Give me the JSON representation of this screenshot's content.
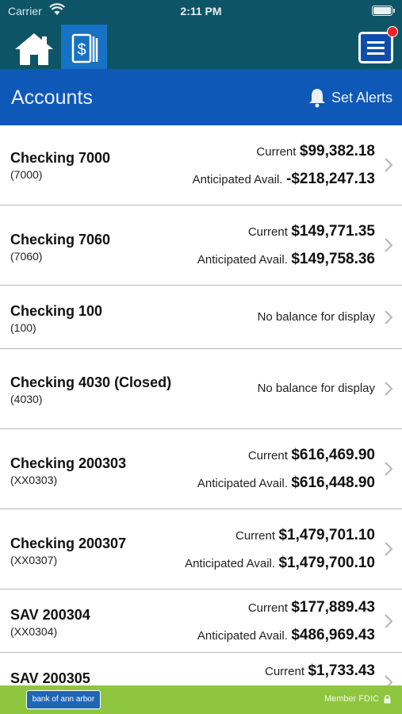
{
  "status_bar": {
    "carrier": "Carrier",
    "time": "2:11 PM"
  },
  "nav": {
    "home_icon": "home-icon",
    "accounts_icon": "dollar-bill-icon",
    "menu_icon": "hamburger-menu-icon",
    "notification_dot_color": "#e8242c",
    "active_tab": "accounts"
  },
  "header": {
    "title": "Accounts",
    "alerts_label": "Set Alerts",
    "alerts_icon": "bell-icon"
  },
  "accounts": [
    {
      "name": "Checking 7000",
      "number": "(7000)",
      "current_label": "Current",
      "current": "$99,382.18",
      "anticipated_label": "Anticipated Avail.",
      "anticipated": "-$218,247.13"
    },
    {
      "name": "Checking 7060",
      "number": "(7060)",
      "current_label": "Current",
      "current": "$149,771.35",
      "anticipated_label": "Anticipated Avail.",
      "anticipated": "$149,758.36"
    },
    {
      "name": "Checking 100",
      "number": "(100)",
      "no_balance": "No balance for display"
    },
    {
      "name": "Checking 4030 (Closed)",
      "number": "(4030)",
      "no_balance": "No balance for display"
    },
    {
      "name": "Checking 200303",
      "number": "(XX0303)",
      "current_label": "Current",
      "current": "$616,469.90",
      "anticipated_label": "Anticipated Avail.",
      "anticipated": "$616,448.90"
    },
    {
      "name": "Checking 200307",
      "number": "(XX0307)",
      "current_label": "Current",
      "current": "$1,479,701.10",
      "anticipated_label": "Anticipated Avail.",
      "anticipated": "$1,479,700.10"
    },
    {
      "name": "SAV 200304",
      "number": "(XX0304)",
      "current_label": "Current",
      "current": "$177,889.43",
      "anticipated_label": "Anticipated Avail.",
      "anticipated": "$486,969.43"
    },
    {
      "name": "SAV 200305",
      "current_label": "Current",
      "current": "$1,733.43"
    }
  ],
  "footer": {
    "logo_text": "bank of ann arbor",
    "fdic": "Member FDIC",
    "lock_icon": "lock-icon"
  },
  "colors": {
    "topbar": "#0d5566",
    "header": "#0e58b8",
    "active_tab": "#1672c4",
    "footer": "#8ec63f"
  }
}
